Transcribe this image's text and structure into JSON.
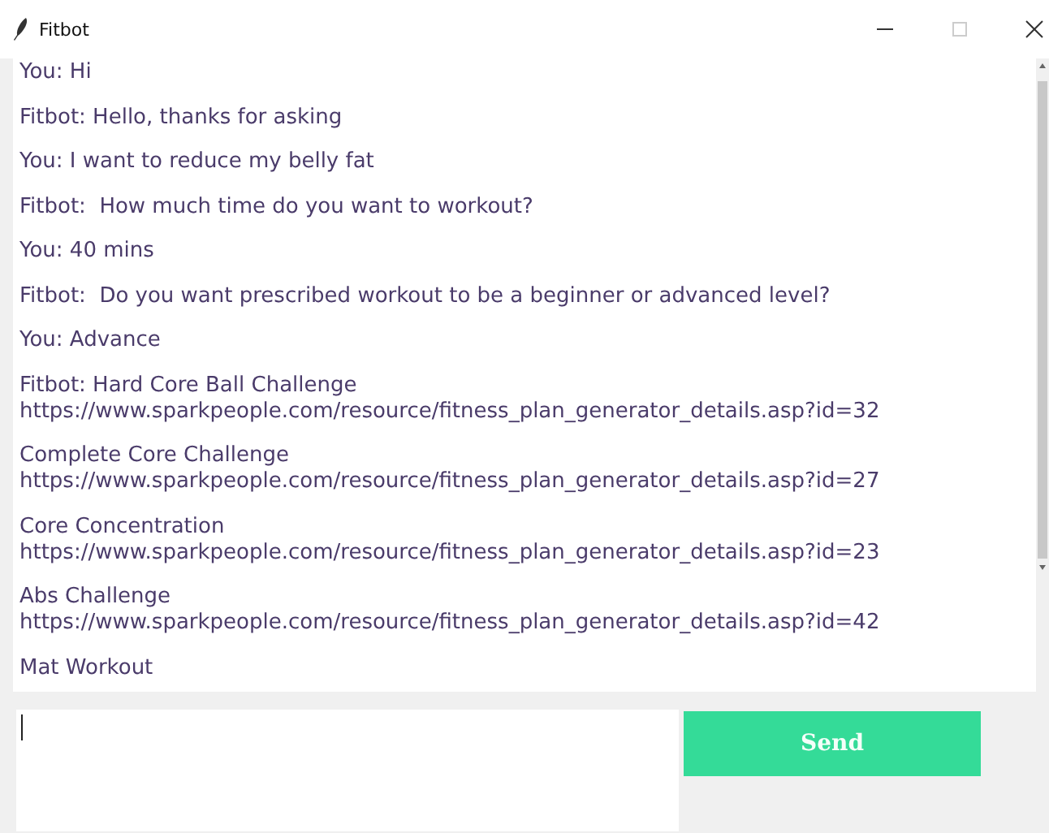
{
  "window": {
    "title": "Fitbot"
  },
  "messages": [
    {
      "text": "You: Hi"
    },
    {
      "text": "Fitbot: Hello, thanks for asking"
    },
    {
      "text": "You: I want to reduce my belly fat"
    },
    {
      "text": "Fitbot:  How much time do you want to workout?"
    },
    {
      "text": "You: 40 mins"
    },
    {
      "text": "Fitbot:  Do you want prescribed workout to be a beginner or advanced level?"
    },
    {
      "text": "You: Advance"
    },
    {
      "text": "Fitbot: Hard Core Ball Challenge",
      "url": "https://www.sparkpeople.com/resource/fitness_plan_generator_details.asp?id=32"
    },
    {
      "text": "Complete Core Challenge",
      "url": "https://www.sparkpeople.com/resource/fitness_plan_generator_details.asp?id=27"
    },
    {
      "text": "Core Concentration",
      "url": "https://www.sparkpeople.com/resource/fitness_plan_generator_details.asp?id=23"
    },
    {
      "text": "Abs Challenge",
      "url": "https://www.sparkpeople.com/resource/fitness_plan_generator_details.asp?id=42"
    },
    {
      "text": "Mat Workout"
    }
  ],
  "send_button": {
    "label": "Send"
  }
}
